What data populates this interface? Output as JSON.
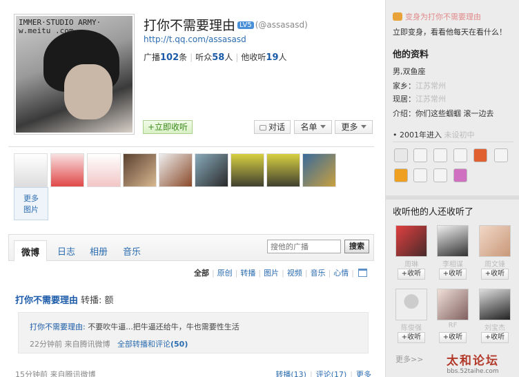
{
  "profile": {
    "name": "打你不需要理由",
    "level_badge": "LV5",
    "handle": "(@assasasd)",
    "url": "http://t.qq.com/assasasd",
    "stats": {
      "broadcasts_label": "广播",
      "broadcasts_count": "102",
      "broadcasts_unit": "条",
      "listeners_label": "听众",
      "listeners_count": "58",
      "listeners_unit": "人",
      "following_label": "他收听",
      "following_count": "19",
      "following_unit": "人"
    },
    "avatar_watermark": "IMMER·STUDIO ARMY·\nw.meitu .com"
  },
  "actions": {
    "follow": "+立即收听",
    "dialog": "对话",
    "list": "名单",
    "more": "更多"
  },
  "photos": {
    "more_line1": "更多",
    "more_line2": "图片"
  },
  "tabs": {
    "weibo": "微博",
    "log": "日志",
    "album": "相册",
    "music": "音乐",
    "search_placeholder": "搜他的广播",
    "search_button": "搜索"
  },
  "filters": [
    "全部",
    "原创",
    "转播",
    "图片",
    "视频",
    "音乐",
    "心情"
  ],
  "post": {
    "author": "打你不需要理由",
    "repost_text": "转播: 额",
    "quote_author": "打你不需要理由:",
    "quote_text": "不要吹牛逼...把牛逼还给牛，牛也需要性生活",
    "quote_time": "22分钟前",
    "quote_source": "来自腾讯微博",
    "quote_link": "全部转播和评论",
    "quote_count": "(50)",
    "time": "15分钟前",
    "source": "来自腾讯微博",
    "repost_action": "转播(13)",
    "comment_action": "评论(17)",
    "more_action": "更多"
  },
  "sidebar": {
    "promo_line": "变身为打你不需要理由",
    "promo_sub": "立即变身，看看他每天在看什么！",
    "profile_title": "他的资料",
    "gender": "男,双鱼座",
    "home_label": "家乡：",
    "home_value": "江苏常州",
    "live_label": "现居：",
    "live_value": "江苏常州",
    "intro_label": "介绍：",
    "intro_value": "你们这些蝈蝈 滚一边去",
    "join_year": "• 2001年进入",
    "join_value": "未设初中",
    "follows_title": "收听他的人还收听了",
    "follows": [
      {
        "name": "周琳",
        "button": "+收听"
      },
      {
        "name": "李相谋",
        "button": "+收听"
      },
      {
        "name": "周文锋",
        "button": "+收听"
      },
      {
        "name": "陈俊强",
        "button": "+收听"
      },
      {
        "name": "RF",
        "button": "+收听"
      },
      {
        "name": "刘宝杰",
        "button": "+收听"
      }
    ],
    "more_follows": "更多>>"
  },
  "watermark": {
    "title": "太和论坛",
    "url": "bbs.52taihe.com"
  }
}
